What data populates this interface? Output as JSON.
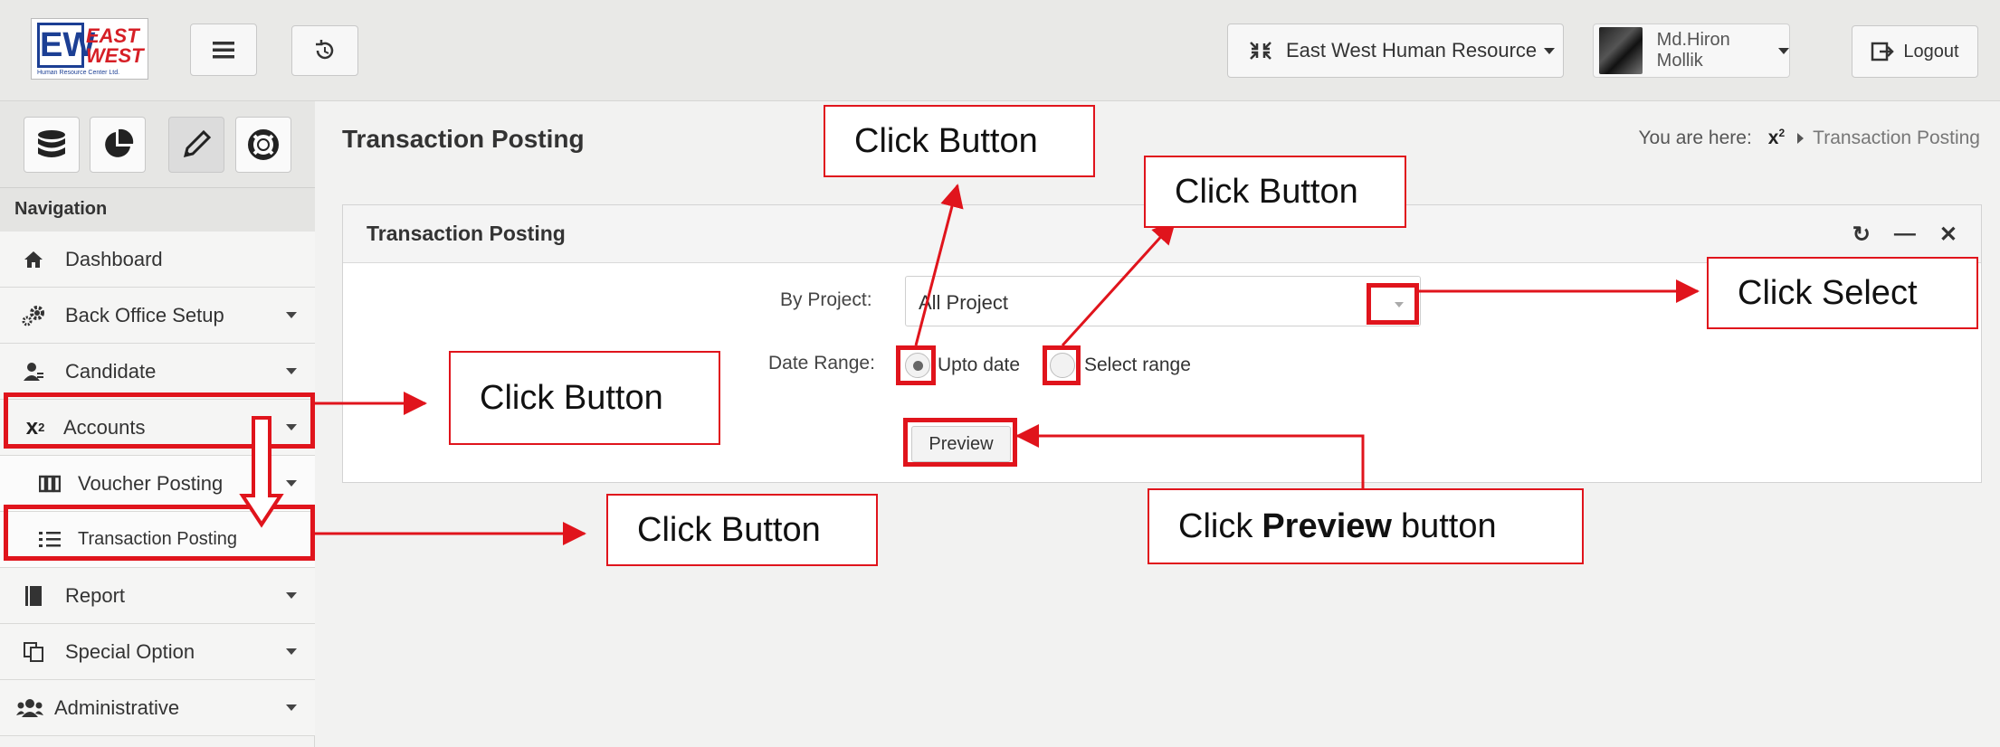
{
  "header": {
    "logo": {
      "mark": "EW",
      "line1": "EAST",
      "line2": "WEST",
      "sub": "Human Resource Center Ltd."
    },
    "company_label": "East West Human Resource",
    "user_label": "Md.Hiron Mollik",
    "logout_label": "Logout",
    "icons": [
      "menu-icon",
      "history-icon",
      "compress-icon",
      "logout-icon"
    ]
  },
  "sidebar": {
    "icon_row": [
      "database-icon",
      "pie-chart-icon",
      "pencil-icon",
      "lifebuoy-icon"
    ],
    "nav_heading": "Navigation",
    "items": [
      {
        "label": "Dashboard",
        "icon": "home-icon"
      },
      {
        "label": "Back Office Setup",
        "icon": "gears-icon"
      },
      {
        "label": "Candidate",
        "icon": "user-icon"
      },
      {
        "label": "Accounts",
        "icon": "superscript-icon"
      },
      {
        "label": "Voucher Posting",
        "icon": "columns-icon"
      },
      {
        "label": "Transaction Posting",
        "icon": "list-icon"
      },
      {
        "label": "Report",
        "icon": "book-icon"
      },
      {
        "label": "Special Option",
        "icon": "copy-icon"
      },
      {
        "label": "Administrative",
        "icon": "users-icon"
      }
    ]
  },
  "main": {
    "page_title": "Transaction Posting",
    "breadcrumb": {
      "prefix": "You are here:",
      "root_icon": "x²",
      "current": "Transaction Posting"
    },
    "panel": {
      "title": "Transaction Posting",
      "tools": [
        "refresh-icon",
        "minimize-icon",
        "close-icon"
      ],
      "project_label": "By Project:",
      "project_value": "All Project",
      "date_range_label": "Date Range:",
      "radio_upto": "Upto date",
      "radio_range": "Select range",
      "preview_label": "Preview"
    }
  },
  "annotations": {
    "accent_color": "#e0141c",
    "callouts": [
      {
        "id": "c1",
        "text": "Click Button"
      },
      {
        "id": "c2",
        "text": "Click Button"
      },
      {
        "id": "c3",
        "text": "Click Select"
      },
      {
        "id": "c4",
        "text": "Click Button"
      },
      {
        "id": "c5",
        "text": "Click Button"
      },
      {
        "id": "c6_pre",
        "text": "Click",
        "bold": "Preview",
        "post": "button"
      }
    ]
  }
}
